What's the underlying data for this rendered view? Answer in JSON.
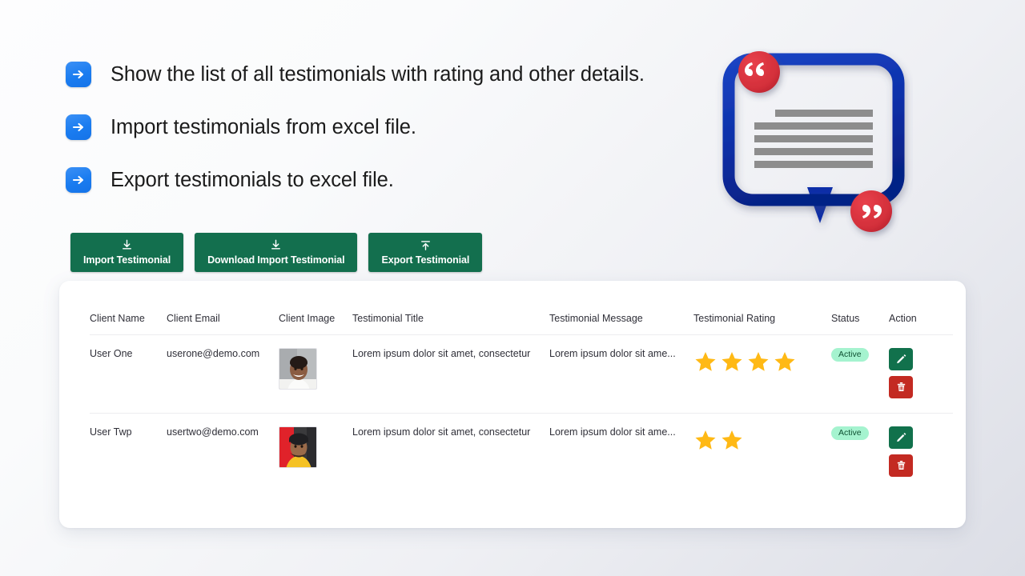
{
  "features": [
    {
      "icon": "arrow-right-icon",
      "text": "Show the list of all testimonials with rating and other details."
    },
    {
      "icon": "arrow-right-icon",
      "text": "Import testimonials from excel file."
    },
    {
      "icon": "arrow-right-icon",
      "text": "Export testimonials to excel file."
    }
  ],
  "toolbar": {
    "buttons": [
      {
        "label": "Import Testimonial",
        "icon": "download-icon"
      },
      {
        "label": "Download Import Testimonial",
        "icon": "download-icon"
      },
      {
        "label": "Export Testimonial",
        "icon": "upload-icon"
      }
    ],
    "button_color": "#136f4e"
  },
  "illustration": {
    "name": "testimonial-speech-bubble",
    "bubble_color": "#0b2fa8",
    "quote_badge_color": "#d32f3a",
    "line_color": "#8d8d8d",
    "text_lines": 5
  },
  "table": {
    "columns": [
      "Client Name",
      "Client Email",
      "Client Image",
      "Testimonial Title",
      "Testimonial Message",
      "Testimonial Rating",
      "Status",
      "Action"
    ],
    "rows": [
      {
        "client_name": "User One",
        "client_email": "userone@demo.com",
        "client_image_alt": "client-photo-one",
        "testimonial_title": "Lorem ipsum dolor sit amet, consectetur",
        "testimonial_message": "Lorem ipsum dolor sit ame...",
        "rating": 4,
        "status": "Active",
        "actions": [
          "edit",
          "delete"
        ]
      },
      {
        "client_name": "User Twp",
        "client_email": "usertwo@demo.com",
        "client_image_alt": "client-photo-two",
        "testimonial_title": "Lorem ipsum dolor sit amet, consectetur",
        "testimonial_message": "Lorem ipsum dolor sit ame...",
        "rating": 2,
        "status": "Active",
        "actions": [
          "edit",
          "delete"
        ]
      }
    ],
    "star_color": "#ffb915",
    "badge_bg": "#a5f3cf",
    "badge_text_color": "#0f5132",
    "edit_color": "#11714c",
    "delete_color": "#c32a22"
  }
}
